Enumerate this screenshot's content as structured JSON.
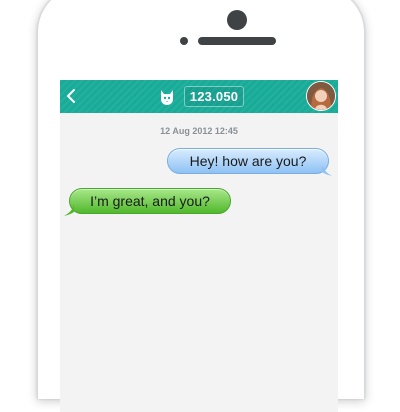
{
  "header": {
    "count": "123.050",
    "back_icon": "chevron-left-icon",
    "mascot_icon": "cat-icon",
    "avatar": "contact-avatar",
    "bar_color": "#19ad9b"
  },
  "conversation": {
    "timestamp": "12 Aug 2012 12:45",
    "messages": [
      {
        "direction": "outgoing",
        "text": "Hey! how are you?",
        "color": "#8ec2f4"
      },
      {
        "direction": "incoming",
        "text": "I’m great, and you?",
        "color": "#51b82c"
      }
    ]
  }
}
